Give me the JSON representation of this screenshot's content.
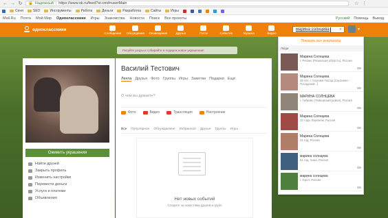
{
  "browser": {
    "secure_label": "Надежный",
    "url": "https://www.ok.ru/feed?st.cmd=userMain"
  },
  "bookmarks": [
    {
      "label": "Сеня",
      "kind": "folder"
    },
    {
      "label": "SEO",
      "kind": "folder"
    },
    {
      "label": "Инструменты",
      "kind": "folder"
    },
    {
      "label": "Работа",
      "kind": "folder"
    },
    {
      "label": "Деньги",
      "kind": "folder"
    },
    {
      "label": "Разработка",
      "kind": "folder"
    },
    {
      "label": "Сайты",
      "kind": "folder"
    },
    {
      "label": "Игры",
      "kind": "folder"
    }
  ],
  "ok_links": {
    "items": [
      "Mail.Ru",
      "Почта",
      "Мой Мир",
      "Одноклассники",
      "Игры",
      "Знакомства",
      "Новости",
      "Поиск",
      "Все проекты"
    ],
    "bold_index": 3,
    "right": [
      "Русский",
      "Помощь",
      "Выход"
    ]
  },
  "topnav": {
    "logo": "одноклассники",
    "items": [
      "Сообщения",
      "Обсуждения",
      "Оповещения",
      "Друзья",
      "Гости",
      "События",
      "Музыка",
      "Видео"
    ],
    "search_value": "марина солнцева"
  },
  "banner": "Рисуйте узоры и собирайте в подарок новое украшение!",
  "profile": {
    "decor_button": "Оживить украшения",
    "menu": [
      "Найти друзей",
      "Закрыть профиль",
      "Изменить настройки",
      "Перевести деньги",
      "Услуги и платежи",
      "Объявления"
    ]
  },
  "main": {
    "name": "Василий Тестович",
    "tabs": [
      "Лента",
      "Друзья",
      "Фото",
      "Группы",
      "Игры",
      "Заметки",
      "Подарки",
      "Ещё"
    ],
    "post_placeholder": "О чем вы думаете?",
    "actions": [
      {
        "label": "Фото",
        "color": "#ee8208"
      },
      {
        "label": "Видео",
        "color": "#e23a2a"
      },
      {
        "label": "Трансляция",
        "color": "#e23a2a"
      },
      {
        "label": "Настроение",
        "color": "#ee8208"
      }
    ],
    "feed_tabs": [
      "Все",
      "Популярное",
      "Обсуждаемое",
      "Избранное",
      "Друзья",
      "Группы",
      "Игры"
    ],
    "empty_title": "Нет новых событий",
    "empty_sub": "Следите за новостями друзей и групп"
  },
  "dropdown": {
    "show_all": "Показать все результаты",
    "header": "Люди",
    "results": [
      {
        "name": "Марина Солнцева",
        "sub": "г. Рязань (Рязанская область), Россия",
        "thumb": "#7a5a55"
      },
      {
        "name": "Марина Солнцева",
        "sub": "48 лет, г. Сергиев Посад (Сергиево-Посадский...)",
        "thumb": "#b38a7d"
      },
      {
        "name": "МАРИНА СОЛНЦЕВА",
        "sub": "г. Тейково (Тейковский район), Россия",
        "thumb": "#8f8679"
      },
      {
        "name": "Марина Солнцева",
        "sub": "22 года, Воронеж, Россия",
        "thumb": "#a04a45"
      },
      {
        "name": "Марина Солнцева",
        "sub": "21 год, Россия",
        "thumb": "#b07d69"
      },
      {
        "name": "марина солнцева",
        "sub": "61 год, Анна, Россия",
        "thumb": "#3f5f7f"
      },
      {
        "name": "марина солнцева",
        "sub": "г. Орел, Россия",
        "thumb": "#4f7f3f"
      }
    ]
  }
}
